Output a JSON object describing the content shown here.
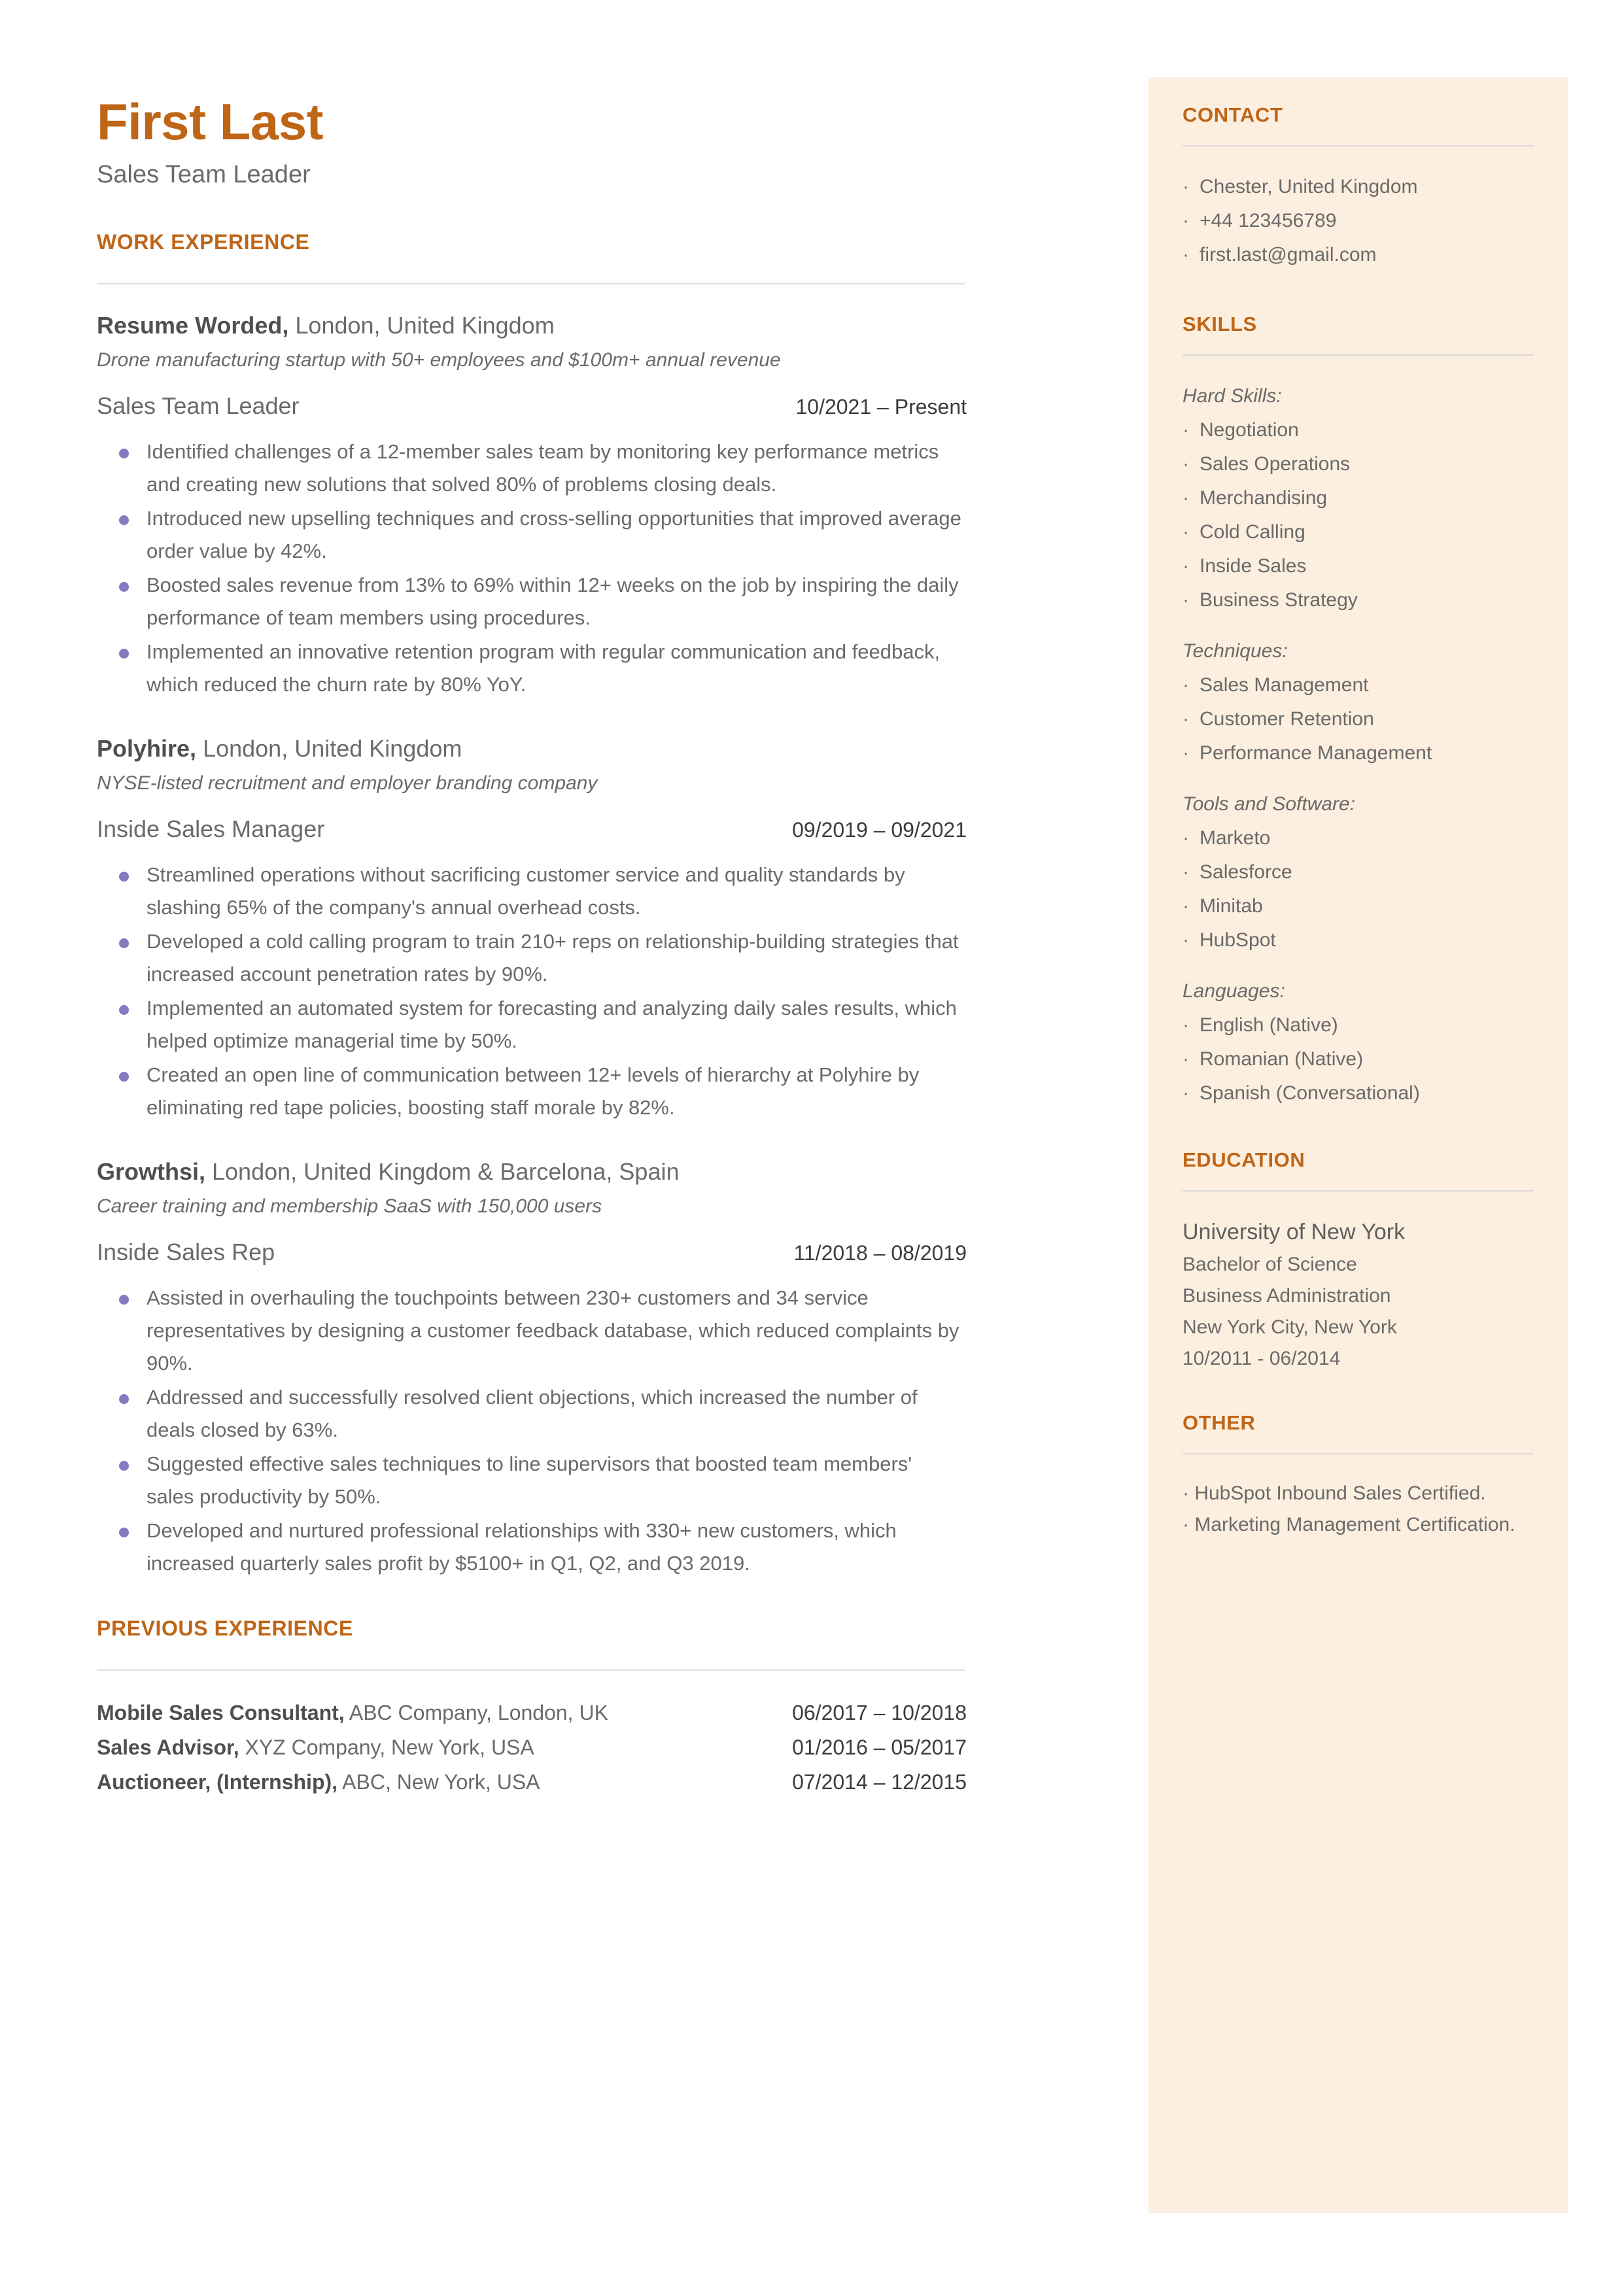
{
  "colors": {
    "accent": "#bf6516",
    "sidebar_bg": "#fdefdf",
    "body_text": "#6a6a6a",
    "bullet": "#8878bf",
    "date_text": "#3c3c3c"
  },
  "header": {
    "name": "First Last",
    "title": "Sales Team Leader"
  },
  "main": {
    "work_experience_heading": "WORK EXPERIENCE",
    "previous_experience_heading": "PREVIOUS EXPERIENCE",
    "jobs": [
      {
        "company_name": "Resume Worded,",
        "company_location": " London, United Kingdom",
        "blurb": "Drone manufacturing startup with 50+ employees and $100m+ annual revenue",
        "role": "Sales Team Leader",
        "dates": "10/2021 – Present",
        "bullets": [
          "Identified challenges of a 12-member sales team by monitoring key performance metrics and creating new solutions that solved 80% of problems closing deals.",
          "Introduced new upselling techniques and cross-selling opportunities that improved average order value by 42%.",
          "Boosted sales revenue from 13% to 69% within 12+ weeks on the job by inspiring the daily performance of team members using procedures.",
          "Implemented an innovative retention program with regular communication and feedback, which reduced the churn rate by 80% YoY."
        ]
      },
      {
        "company_name": "Polyhire,",
        "company_location": " London, United Kingdom",
        "blurb": "NYSE-listed recruitment and employer branding company",
        "role": "Inside Sales Manager",
        "dates": "09/2019 – 09/2021",
        "bullets": [
          "Streamlined operations without sacrificing customer service and quality standards by slashing 65% of the company's annual overhead costs.",
          "Developed a cold calling program to train 210+ reps on relationship-building strategies that increased account penetration rates by 90%.",
          "Implemented an automated system for forecasting and analyzing daily sales results, which helped optimize managerial time by 50%.",
          "Created an open line of communication between 12+ levels of hierarchy at Polyhire by eliminating red tape policies, boosting staff morale by 82%."
        ]
      },
      {
        "company_name": "Growthsi,",
        "company_location": " London, United Kingdom & Barcelona, Spain",
        "blurb": "Career training and membership SaaS with 150,000 users",
        "role": "Inside Sales Rep",
        "dates": "11/2018 – 08/2019",
        "bullets": [
          "Assisted in overhauling the touchpoints between 230+ customers and 34 service representatives by designing a customer feedback database, which reduced complaints by 90%.",
          "Addressed and successfully resolved client objections, which increased the number of deals closed by 63%.",
          "Suggested effective sales techniques to line supervisors that boosted team members' sales productivity by 50%.",
          "Developed and nurtured professional relationships with 330+ new customers, which increased quarterly sales profit by $5100+ in Q1, Q2, and Q3 2019."
        ]
      }
    ],
    "previous_experience": [
      {
        "role": "Mobile Sales Consultant,",
        "detail": " ABC Company, London, UK",
        "dates": "06/2017 – 10/2018"
      },
      {
        "role": "Sales Advisor,",
        "detail": " XYZ Company, New York, USA",
        "dates": "01/2016 – 05/2017"
      },
      {
        "role": "Auctioneer, (Internship),",
        "detail": " ABC, New York, USA",
        "dates": "07/2014 – 12/2015"
      }
    ]
  },
  "sidebar": {
    "contact": {
      "heading": "CONTACT",
      "items": [
        "Chester, United Kingdom",
        "+44 123456789",
        "first.last@gmail.com"
      ]
    },
    "skills": {
      "heading": "SKILLS",
      "groups": [
        {
          "label": "Hard Skills:",
          "items": [
            "Negotiation",
            "Sales Operations",
            "Merchandising",
            "Cold Calling",
            "Inside Sales",
            "Business Strategy"
          ]
        },
        {
          "label": "Techniques:",
          "items": [
            "Sales Management",
            "Customer Retention",
            "Performance Management"
          ]
        },
        {
          "label": "Tools and Software:",
          "items": [
            "Marketo",
            "Salesforce",
            "Minitab",
            "HubSpot"
          ]
        },
        {
          "label": "Languages:",
          "items": [
            "English (Native)",
            "Romanian (Native)",
            "Spanish (Conversational)"
          ]
        }
      ]
    },
    "education": {
      "heading": "EDUCATION",
      "school": "University of New York",
      "degree": "Bachelor of Science",
      "field": "Business Administration",
      "location": "New York City, New York",
      "dates": "10/2011 - 06/2014"
    },
    "other": {
      "heading": "OTHER",
      "items": [
        "HubSpot Inbound Sales Certified.",
        "Marketing Management Certification."
      ]
    }
  }
}
